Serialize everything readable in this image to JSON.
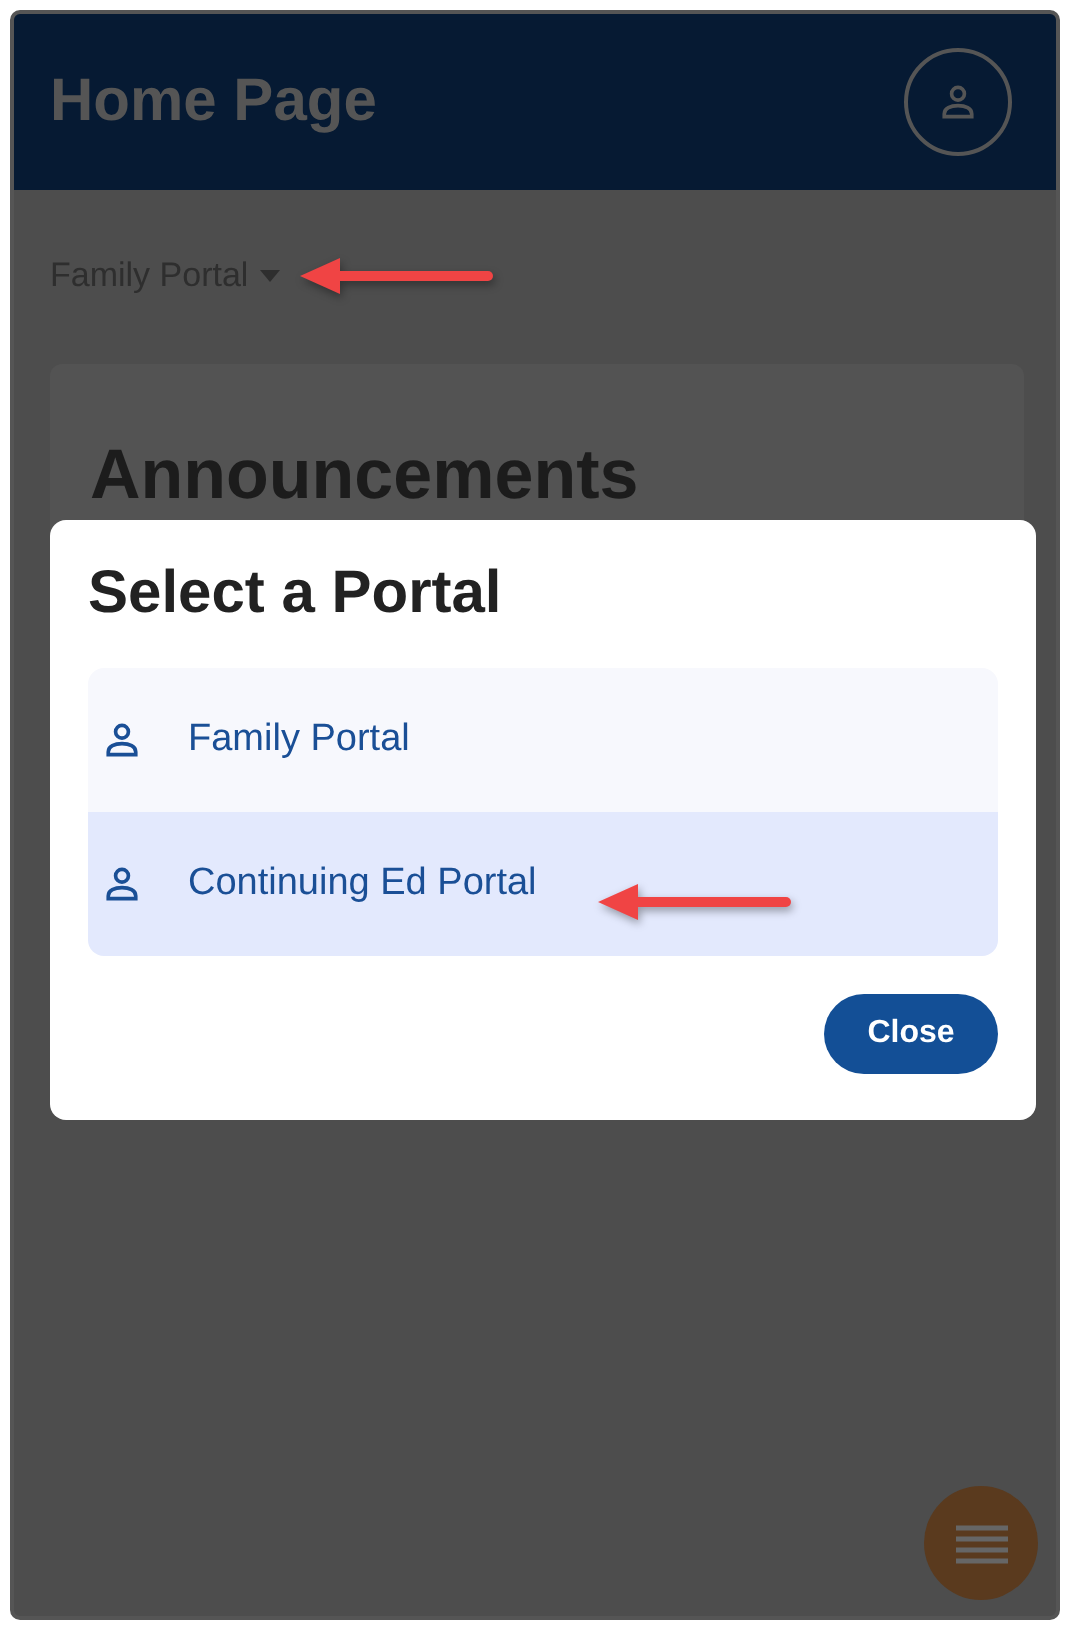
{
  "header": {
    "title": "Home Page"
  },
  "portal_selector": {
    "label": "Family Portal"
  },
  "card": {
    "title": "Announcements"
  },
  "dialog": {
    "title": "Select a Portal",
    "portals": [
      {
        "label": "Family Portal",
        "selected": false
      },
      {
        "label": "Continuing Ed Portal",
        "selected": true
      }
    ],
    "close_button": "Close"
  }
}
